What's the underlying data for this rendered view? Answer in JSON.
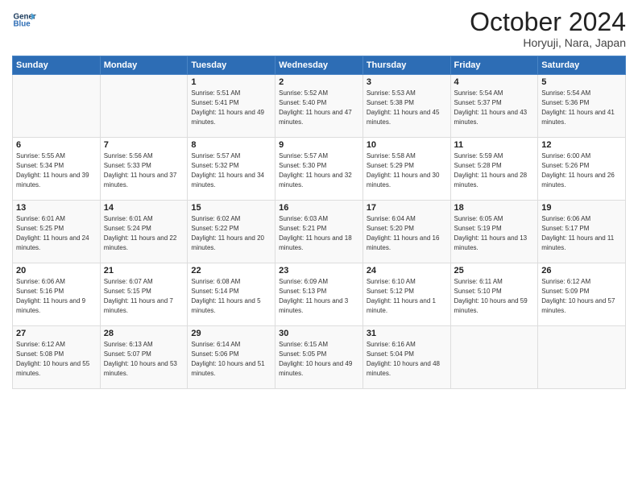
{
  "header": {
    "logo_line1": "General",
    "logo_line2": "Blue",
    "month": "October 2024",
    "location": "Horyuji, Nara, Japan"
  },
  "weekdays": [
    "Sunday",
    "Monday",
    "Tuesday",
    "Wednesday",
    "Thursday",
    "Friday",
    "Saturday"
  ],
  "weeks": [
    [
      {
        "day": "",
        "info": ""
      },
      {
        "day": "",
        "info": ""
      },
      {
        "day": "1",
        "info": "Sunrise: 5:51 AM\nSunset: 5:41 PM\nDaylight: 11 hours and 49 minutes."
      },
      {
        "day": "2",
        "info": "Sunrise: 5:52 AM\nSunset: 5:40 PM\nDaylight: 11 hours and 47 minutes."
      },
      {
        "day": "3",
        "info": "Sunrise: 5:53 AM\nSunset: 5:38 PM\nDaylight: 11 hours and 45 minutes."
      },
      {
        "day": "4",
        "info": "Sunrise: 5:54 AM\nSunset: 5:37 PM\nDaylight: 11 hours and 43 minutes."
      },
      {
        "day": "5",
        "info": "Sunrise: 5:54 AM\nSunset: 5:36 PM\nDaylight: 11 hours and 41 minutes."
      }
    ],
    [
      {
        "day": "6",
        "info": "Sunrise: 5:55 AM\nSunset: 5:34 PM\nDaylight: 11 hours and 39 minutes."
      },
      {
        "day": "7",
        "info": "Sunrise: 5:56 AM\nSunset: 5:33 PM\nDaylight: 11 hours and 37 minutes."
      },
      {
        "day": "8",
        "info": "Sunrise: 5:57 AM\nSunset: 5:32 PM\nDaylight: 11 hours and 34 minutes."
      },
      {
        "day": "9",
        "info": "Sunrise: 5:57 AM\nSunset: 5:30 PM\nDaylight: 11 hours and 32 minutes."
      },
      {
        "day": "10",
        "info": "Sunrise: 5:58 AM\nSunset: 5:29 PM\nDaylight: 11 hours and 30 minutes."
      },
      {
        "day": "11",
        "info": "Sunrise: 5:59 AM\nSunset: 5:28 PM\nDaylight: 11 hours and 28 minutes."
      },
      {
        "day": "12",
        "info": "Sunrise: 6:00 AM\nSunset: 5:26 PM\nDaylight: 11 hours and 26 minutes."
      }
    ],
    [
      {
        "day": "13",
        "info": "Sunrise: 6:01 AM\nSunset: 5:25 PM\nDaylight: 11 hours and 24 minutes."
      },
      {
        "day": "14",
        "info": "Sunrise: 6:01 AM\nSunset: 5:24 PM\nDaylight: 11 hours and 22 minutes."
      },
      {
        "day": "15",
        "info": "Sunrise: 6:02 AM\nSunset: 5:22 PM\nDaylight: 11 hours and 20 minutes."
      },
      {
        "day": "16",
        "info": "Sunrise: 6:03 AM\nSunset: 5:21 PM\nDaylight: 11 hours and 18 minutes."
      },
      {
        "day": "17",
        "info": "Sunrise: 6:04 AM\nSunset: 5:20 PM\nDaylight: 11 hours and 16 minutes."
      },
      {
        "day": "18",
        "info": "Sunrise: 6:05 AM\nSunset: 5:19 PM\nDaylight: 11 hours and 13 minutes."
      },
      {
        "day": "19",
        "info": "Sunrise: 6:06 AM\nSunset: 5:17 PM\nDaylight: 11 hours and 11 minutes."
      }
    ],
    [
      {
        "day": "20",
        "info": "Sunrise: 6:06 AM\nSunset: 5:16 PM\nDaylight: 11 hours and 9 minutes."
      },
      {
        "day": "21",
        "info": "Sunrise: 6:07 AM\nSunset: 5:15 PM\nDaylight: 11 hours and 7 minutes."
      },
      {
        "day": "22",
        "info": "Sunrise: 6:08 AM\nSunset: 5:14 PM\nDaylight: 11 hours and 5 minutes."
      },
      {
        "day": "23",
        "info": "Sunrise: 6:09 AM\nSunset: 5:13 PM\nDaylight: 11 hours and 3 minutes."
      },
      {
        "day": "24",
        "info": "Sunrise: 6:10 AM\nSunset: 5:12 PM\nDaylight: 11 hours and 1 minute."
      },
      {
        "day": "25",
        "info": "Sunrise: 6:11 AM\nSunset: 5:10 PM\nDaylight: 10 hours and 59 minutes."
      },
      {
        "day": "26",
        "info": "Sunrise: 6:12 AM\nSunset: 5:09 PM\nDaylight: 10 hours and 57 minutes."
      }
    ],
    [
      {
        "day": "27",
        "info": "Sunrise: 6:12 AM\nSunset: 5:08 PM\nDaylight: 10 hours and 55 minutes."
      },
      {
        "day": "28",
        "info": "Sunrise: 6:13 AM\nSunset: 5:07 PM\nDaylight: 10 hours and 53 minutes."
      },
      {
        "day": "29",
        "info": "Sunrise: 6:14 AM\nSunset: 5:06 PM\nDaylight: 10 hours and 51 minutes."
      },
      {
        "day": "30",
        "info": "Sunrise: 6:15 AM\nSunset: 5:05 PM\nDaylight: 10 hours and 49 minutes."
      },
      {
        "day": "31",
        "info": "Sunrise: 6:16 AM\nSunset: 5:04 PM\nDaylight: 10 hours and 48 minutes."
      },
      {
        "day": "",
        "info": ""
      },
      {
        "day": "",
        "info": ""
      }
    ]
  ]
}
